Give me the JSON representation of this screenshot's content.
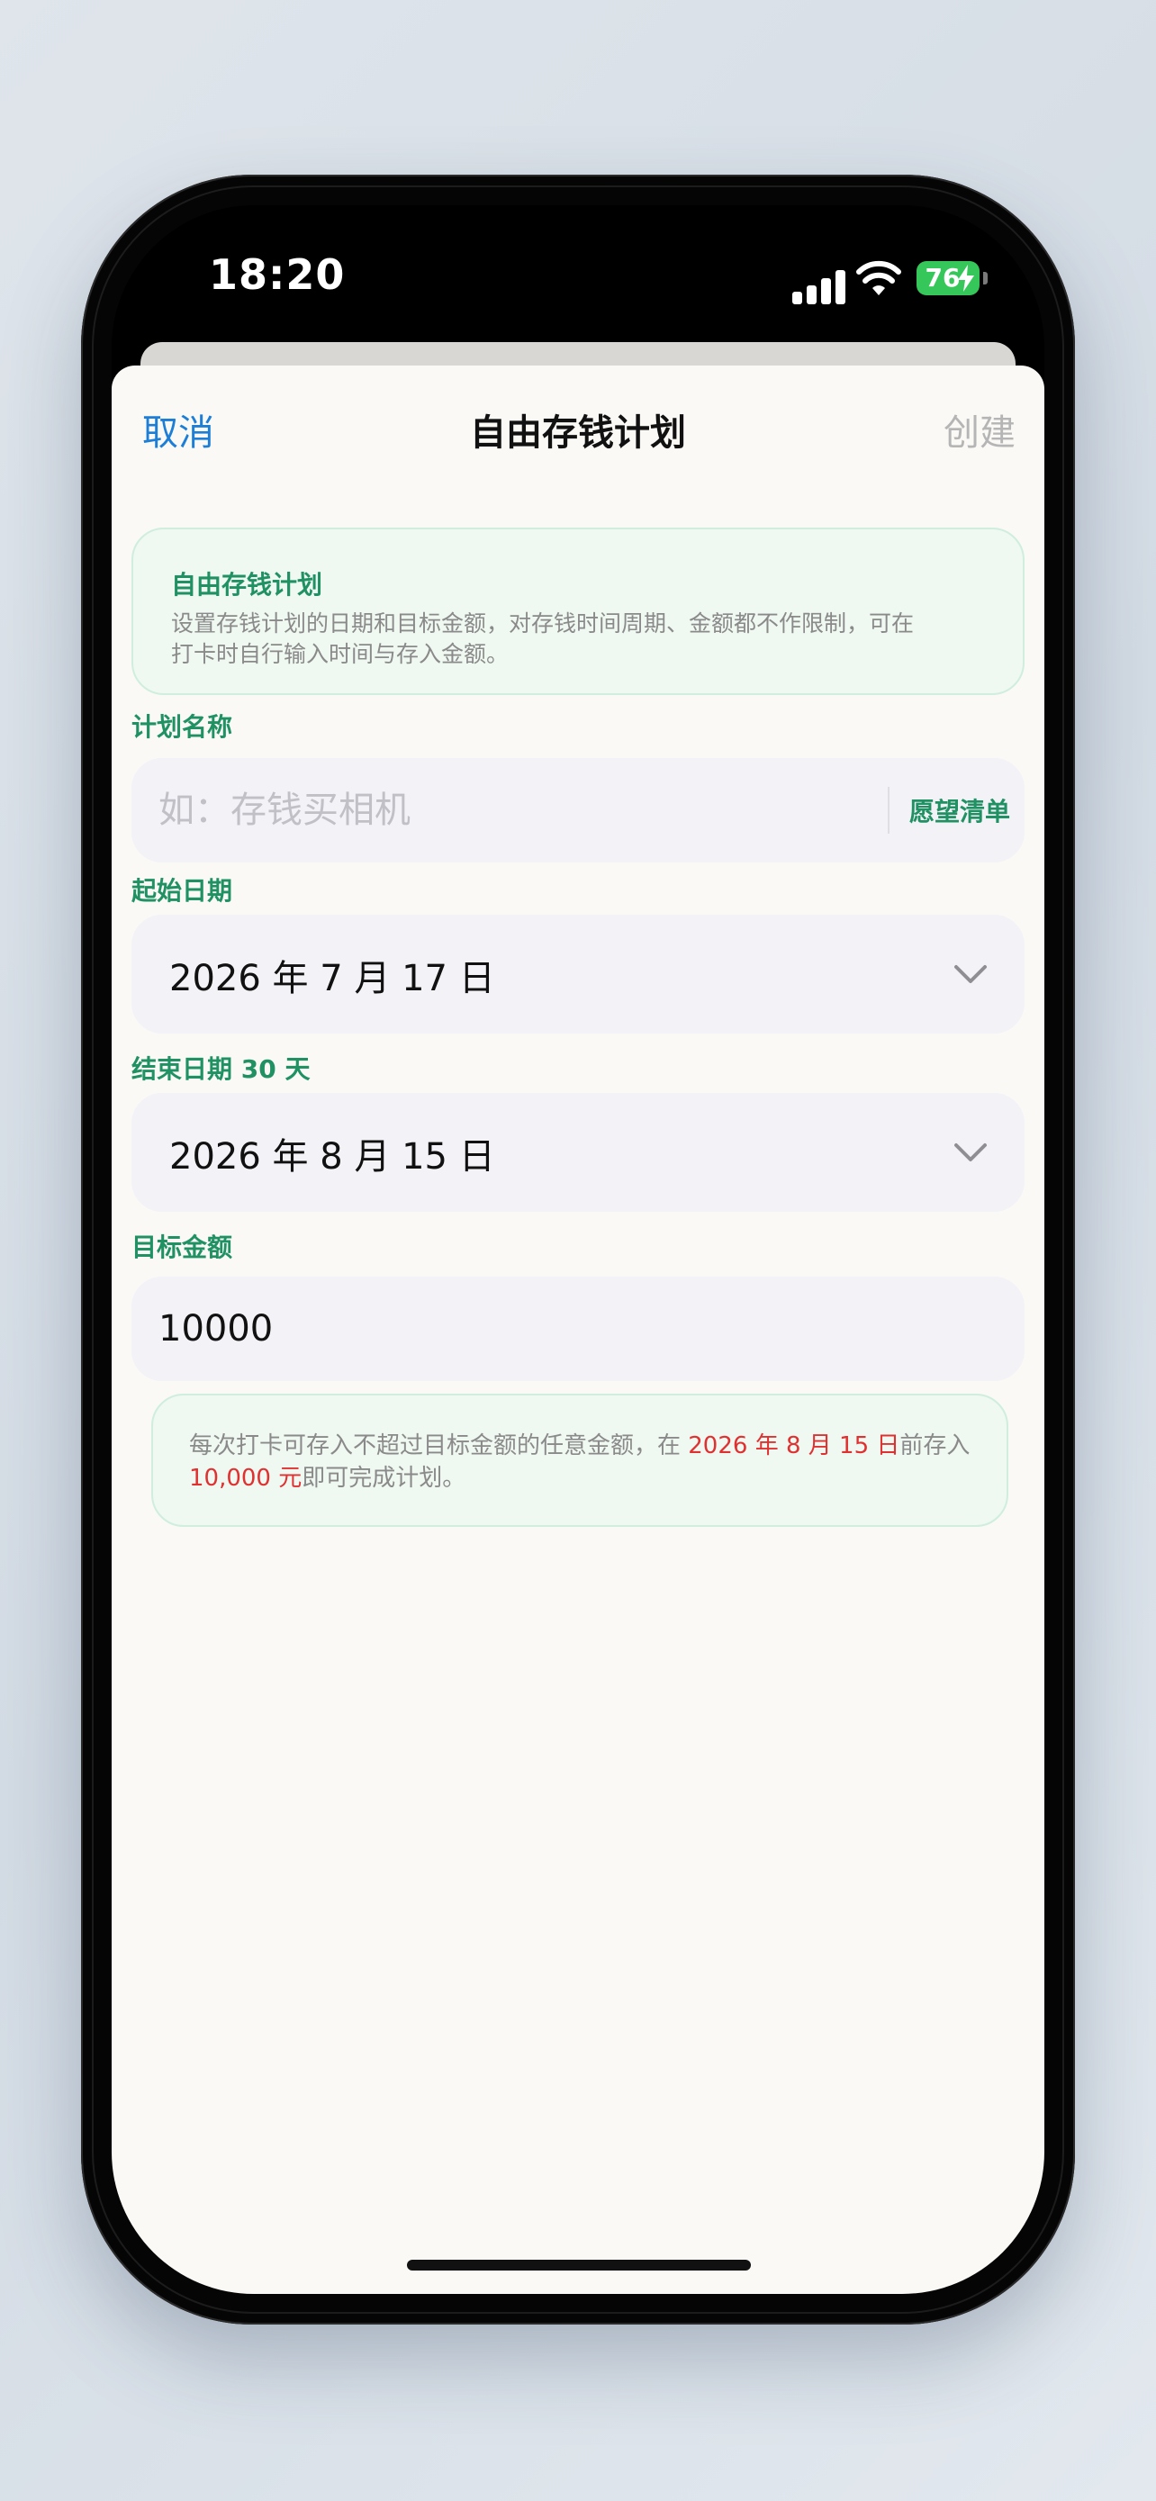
{
  "status": {
    "time": "18:20",
    "battery": "76"
  },
  "nav": {
    "cancel": "取消",
    "title": "自由存钱计划",
    "create": "创建"
  },
  "info": {
    "title": "自由存钱计划",
    "desc_line1": "设置存钱计划的日期和目标金额，对存钱时间周期、金额都不作限制，可在",
    "desc_line2": "打卡时自行输入时间与存入金额。"
  },
  "name_field": {
    "label": "计划名称",
    "placeholder": "如：存钱买相机",
    "value": "",
    "wishlist": "愿望清单"
  },
  "start_date": {
    "label": "起始日期",
    "value": "2026 年 7 月 17 日"
  },
  "end_date": {
    "label": "结束日期 30 天",
    "value": "2026 年 8 月 15 日"
  },
  "amount": {
    "label": "目标金额",
    "value": "10000"
  },
  "tip": {
    "part1": "每次打卡可存入不超过目标金额的任意金额，在 ",
    "date": "2026 年 8 月 15 日",
    "part2": "前存入",
    "amount": "10,000 元",
    "part3": "即可完成计划。"
  },
  "colors": {
    "accent_green": "#1f9162",
    "link_blue": "#1c7ed6",
    "highlight_red": "#e03131",
    "battery_green": "#35c759"
  },
  "icons": [
    "signal-icon",
    "wifi-icon",
    "battery-icon",
    "chevron-down-icon"
  ]
}
